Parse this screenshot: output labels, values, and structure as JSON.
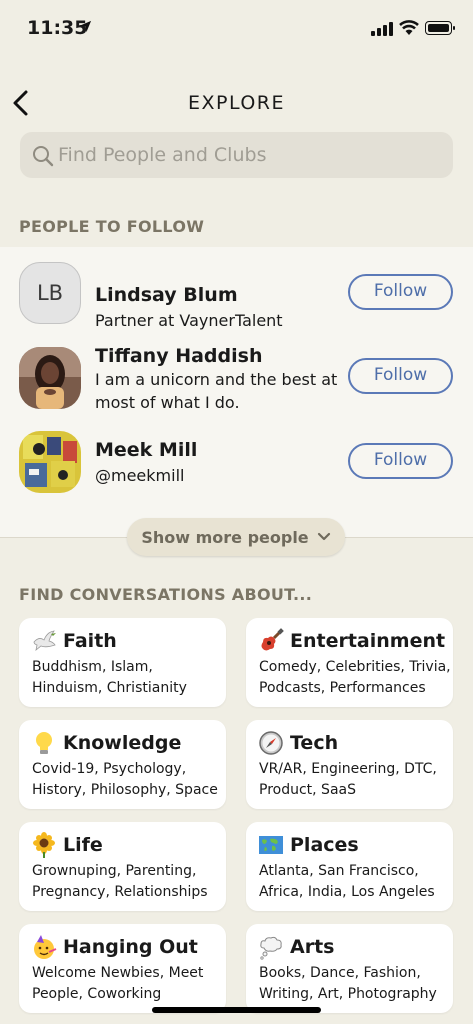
{
  "status_bar": {
    "time": "11:35"
  },
  "header": {
    "title": "EXPLORE"
  },
  "search": {
    "placeholder": "Find People and Clubs"
  },
  "people_section": {
    "label": "PEOPLE TO FOLLOW",
    "people": [
      {
        "name": "Lindsay Blum",
        "bio": "Partner at VaynerTalent",
        "initials": "LB",
        "follow_label": "Follow"
      },
      {
        "name": "Tiffany Haddish",
        "bio": "I am a unicorn and the best at most of what I do.",
        "follow_label": "Follow"
      },
      {
        "name": "Meek Mill",
        "bio": "@meekmill",
        "follow_label": "Follow"
      }
    ],
    "show_more_label": "Show more people"
  },
  "topics_section": {
    "label": "FIND CONVERSATIONS ABOUT...",
    "topics": [
      {
        "title": "Faith",
        "subtitle": "Buddhism, Islam, Hinduism, Christianity",
        "icon": "dove-icon"
      },
      {
        "title": "Entertainment",
        "subtitle": "Comedy, Celebrities, Trivia, Podcasts, Performances",
        "icon": "guitar-icon"
      },
      {
        "title": "Knowledge",
        "subtitle": "Covid-19, Psychology, History, Philosophy, Space",
        "icon": "light-bulb-icon"
      },
      {
        "title": "Tech",
        "subtitle": "VR/AR, Engineering, DTC, Product, SaaS",
        "icon": "compass-icon"
      },
      {
        "title": "Life",
        "subtitle": "Grownuping, Parenting, Pregnancy, Relationships",
        "icon": "sunflower-icon"
      },
      {
        "title": "Places",
        "subtitle": "Atlanta, San Francisco, Africa, India, Los Angeles",
        "icon": "world-map-icon"
      },
      {
        "title": "Hanging Out",
        "subtitle": "Welcome Newbies, Meet People, Coworking",
        "icon": "party-face-icon"
      },
      {
        "title": "Arts",
        "subtitle": "Books, Dance, Fashion, Writing, Art, Photography",
        "icon": "thought-balloon-icon"
      }
    ]
  },
  "colors": {
    "background": "#f0eee4",
    "panel": "#f7f6f1",
    "follow_blue": "#5b79b7",
    "section_label": "#7b7565"
  }
}
